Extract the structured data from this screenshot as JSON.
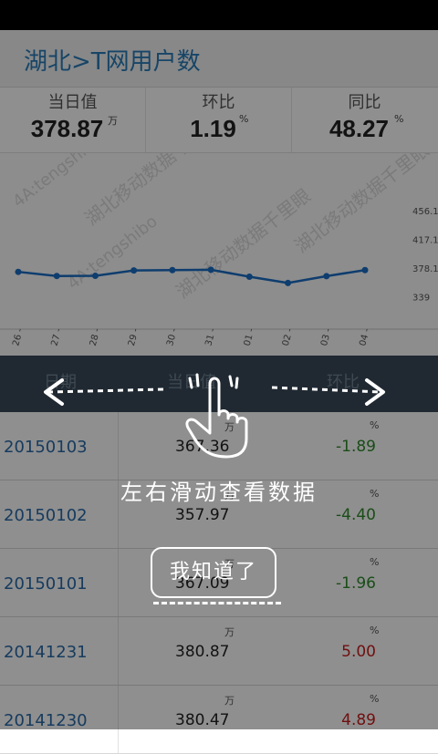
{
  "titlebar": {
    "title": "湖北>T网用户数"
  },
  "kpis": [
    {
      "label": "当日值",
      "value": "378.87",
      "unit": "万"
    },
    {
      "label": "环比",
      "value": "1.19",
      "unit": "%"
    },
    {
      "label": "同比",
      "value": "48.27",
      "unit": "%"
    }
  ],
  "chart_data": {
    "type": "line",
    "categories": [
      "26",
      "27",
      "28",
      "29",
      "30",
      "31",
      "01",
      "02",
      "03",
      "04"
    ],
    "values": [
      373.1,
      367.5,
      367.8,
      375.0,
      375.5,
      376.0,
      366.5,
      358.0,
      367.3,
      375.5
    ],
    "yticks": [
      "456.1",
      "417.1",
      "378.1",
      "339"
    ],
    "ylim": [
      330,
      460
    ],
    "color": "#1a6dc4",
    "watermarks": [
      "4A:tengshibo",
      "湖北移动数据千里眼"
    ]
  },
  "table": {
    "headers": [
      "日期",
      "当日值",
      "环比"
    ],
    "rows": [
      {
        "date": "20150103",
        "value": "367.36",
        "unit": "万",
        "pct": "-1.89",
        "pct_unit": "%",
        "sign": "neg"
      },
      {
        "date": "20150102",
        "value": "357.97",
        "unit": "万",
        "pct": "-4.40",
        "pct_unit": "%",
        "sign": "neg"
      },
      {
        "date": "20150101",
        "value": "367.09",
        "unit": "万",
        "pct": "-1.96",
        "pct_unit": "%",
        "sign": "neg"
      },
      {
        "date": "20141231",
        "value": "380.87",
        "unit": "万",
        "pct": "5.00",
        "pct_unit": "%",
        "sign": "pos"
      },
      {
        "date": "20141230",
        "value": "380.47",
        "unit": "万",
        "pct": "4.89",
        "pct_unit": "%",
        "sign": "pos"
      }
    ]
  },
  "overlay": {
    "hint": "左右滑动查看数据",
    "button": "我知道了",
    "icon": "swipe-hand-icon"
  },
  "colors": {
    "title": "#2a7bb8",
    "header_bg": "#394a59",
    "positive": "#c81d1d",
    "negative": "#2f8a2b"
  }
}
